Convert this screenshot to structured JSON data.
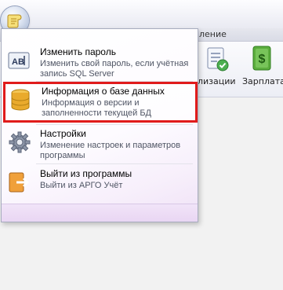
{
  "window": {
    "tab_fragment": "ление"
  },
  "ribbon": {
    "buttons": [
      {
        "label": "лизации",
        "icon": "checklist-icon"
      },
      {
        "label": "Зарплата",
        "icon": "money-icon"
      }
    ]
  },
  "app_menu": {
    "items": [
      {
        "title": "Изменить пароль",
        "description": "Изменить свой пароль, если учётная запись SQL Server",
        "icon": "change-password-icon"
      },
      {
        "title": "Информация о базе данных",
        "description": "Информация о версии и заполненности текущей БД",
        "icon": "database-icon",
        "highlighted": true
      },
      {
        "title": "Настройки",
        "description": "Изменение настроек и параметров программы",
        "icon": "settings-gear-icon"
      },
      {
        "title": "Выйти из программы",
        "description": "Выйти из АРГО Учёт",
        "icon": "exit-icon"
      }
    ]
  },
  "colors": {
    "highlight_border": "#e01b1b",
    "menu_text": "#000000",
    "menu_desc": "#4f5564"
  }
}
